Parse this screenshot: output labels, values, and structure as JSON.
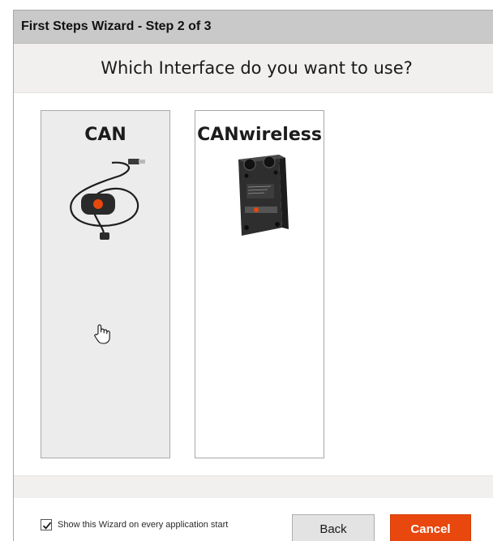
{
  "window": {
    "title": "First Steps Wizard - Step 2 of 3"
  },
  "question": "Which Interface do you want to use?",
  "cards": [
    {
      "label": "CAN",
      "icon": "usb-can-cable-icon",
      "selected": true
    },
    {
      "label": "CANwireless",
      "icon": "wireless-module-icon",
      "selected": false
    }
  ],
  "footer": {
    "checkbox_label": "Show this Wizard on every application start",
    "checkbox_checked": true,
    "back_label": "Back",
    "cancel_label": "Cancel"
  },
  "colors": {
    "accent": "#e8470e",
    "titlebar": "#c9c9c9",
    "band": "#f1f0ef",
    "selected_card": "#ececec"
  }
}
